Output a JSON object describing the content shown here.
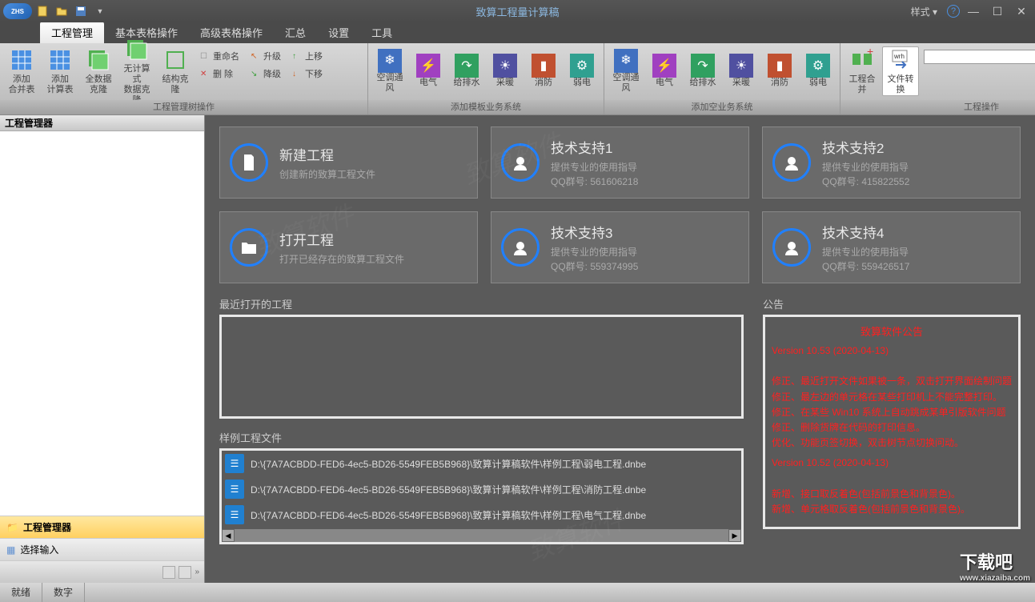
{
  "title": "致算工程量计算稿",
  "logo_text": "ZHS",
  "style_menu": "样式",
  "tabs": {
    "t0": "工程管理",
    "t1": "基本表格操作",
    "t2": "高级表格操作",
    "t3": "汇总",
    "t4": "设置",
    "t5": "工具"
  },
  "ribbon": {
    "g1_label": "工程管理树操作",
    "g2_label": "添加模板业务系统",
    "g3_label": "添加空业务系统",
    "g4_label": "工程操作",
    "add_merge": "添加\n合并表",
    "add_calc": "添加\n计算表",
    "clone_all": "全数据\n克隆",
    "clone_noexp": "无计算式\n数据克隆",
    "clone_struct": "结构克隆",
    "rename": "重命名",
    "delete": "删  除",
    "upgrade": "升级",
    "downgrade": "降级",
    "moveup": "上移",
    "movedown": "下移",
    "biz_hvac": "空调通风",
    "biz_elec": "电气",
    "biz_drain": "给排水",
    "biz_heat": "采暖",
    "biz_fire": "消防",
    "biz_weak": "弱电",
    "proj_merge": "工程合并",
    "file_convert": "文件转换"
  },
  "sidebar": {
    "header": "工程管理器",
    "tab1": "工程管理器",
    "tab2": "选择输入"
  },
  "cards": {
    "new_title": "新建工程",
    "new_sub": "创建新的致算工程文件",
    "open_title": "打开工程",
    "open_sub": "打开已经存在的致算工程文件",
    "sup1_title": "技术支持1",
    "sup_guide": "提供专业的使用指导",
    "sup1_qq": "QQ群号: 561606218",
    "sup2_title": "技术支持2",
    "sup2_qq": "QQ群号: 415822552",
    "sup3_title": "技术支持3",
    "sup3_qq": "QQ群号: 559374995",
    "sup4_title": "技术支持4",
    "sup4_qq": "QQ群号: 559426517"
  },
  "sections": {
    "recent": "最近打开的工程",
    "samples": "样例工程文件",
    "announce": "公告"
  },
  "samples": {
    "s0": "D:\\{7A7ACBDD-FED6-4ec5-BD26-5549FEB5B968}\\致算计算稿软件\\样例工程\\弱电工程.dnbe",
    "s1": "D:\\{7A7ACBDD-FED6-4ec5-BD26-5549FEB5B968}\\致算计算稿软件\\样例工程\\消防工程.dnbe",
    "s2": "D:\\{7A7ACBDD-FED6-4ec5-BD26-5549FEB5B968}\\致算计算稿软件\\样例工程\\电气工程.dnbe"
  },
  "announce": {
    "title": "致算软件公告",
    "v1": "Version 10.53  (2020-04-13)",
    "l1": "修正、最近打开文件如果被一条，双击打开界面绘制问题",
    "l2": "修正、最左边的单元格在某些打印机上不能完整打印。",
    "l3": "修正、在某些 Win10 系统上自动跳成某单引版软件问题",
    "l4": "修正、删除货牌在代码的打印信息。",
    "l5": "优化、功能页签切换，双击树节点切换问动。",
    "v2": "Version 10.52  (2020-04-13)",
    "l6": "新增、接口取反着色(包括前景色和背景色)。",
    "l7": "新增、单元格取反着色(包括前景色和背景色)。"
  },
  "status": {
    "ready": "就绪",
    "num": "数字"
  },
  "watermark": {
    "name": "下载吧",
    "url": "www.xiazaiba.com"
  }
}
